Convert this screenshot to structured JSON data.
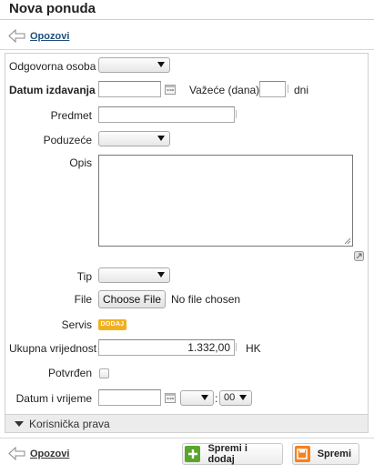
{
  "page": {
    "title": "Nova ponuda"
  },
  "nav": {
    "back_label": "Opozovi"
  },
  "form": {
    "odgovorna_osoba": {
      "label": "Odgovorna osoba",
      "value": ""
    },
    "datum_izdavanja": {
      "label": "Datum izdavanja",
      "value": ""
    },
    "vazece": {
      "label": "Važeće (dana)",
      "value": "",
      "unit": "dni"
    },
    "predmet": {
      "label": "Predmet",
      "value": ""
    },
    "poduzece": {
      "label": "Poduzeće",
      "value": ""
    },
    "opis": {
      "label": "Opis",
      "value": ""
    },
    "tip": {
      "label": "Tip",
      "value": ""
    },
    "file": {
      "label": "File",
      "button": "Choose File",
      "status": "No file chosen"
    },
    "servis": {
      "label": "Servis",
      "badge": "DODAJ"
    },
    "ukupna": {
      "label": "Ukupna vrijednost",
      "value": "1.332,00",
      "currency": "HK"
    },
    "potvrden": {
      "label": "Potvrđen",
      "checked": false
    },
    "datum_vrijeme": {
      "label": "Datum i vrijeme",
      "date": "",
      "hour": "",
      "minute": "00",
      "separator": ":"
    }
  },
  "sections": {
    "korisnicka_prava": "Korisnička prava"
  },
  "actions": {
    "save_add": "Spremi i dodaj",
    "save": "Spremi"
  },
  "colors": {
    "link": "#1f4f7a",
    "badge": "#f2b01e",
    "save_add_icon": "#5aa62c",
    "save_icon": "#f5821f"
  },
  "icons": [
    "back-arrow-icon",
    "calendar-icon",
    "dropdown-caret-icon",
    "resize-icon",
    "plus-icon",
    "floppy-disk-icon",
    "triangle-down-icon"
  ]
}
